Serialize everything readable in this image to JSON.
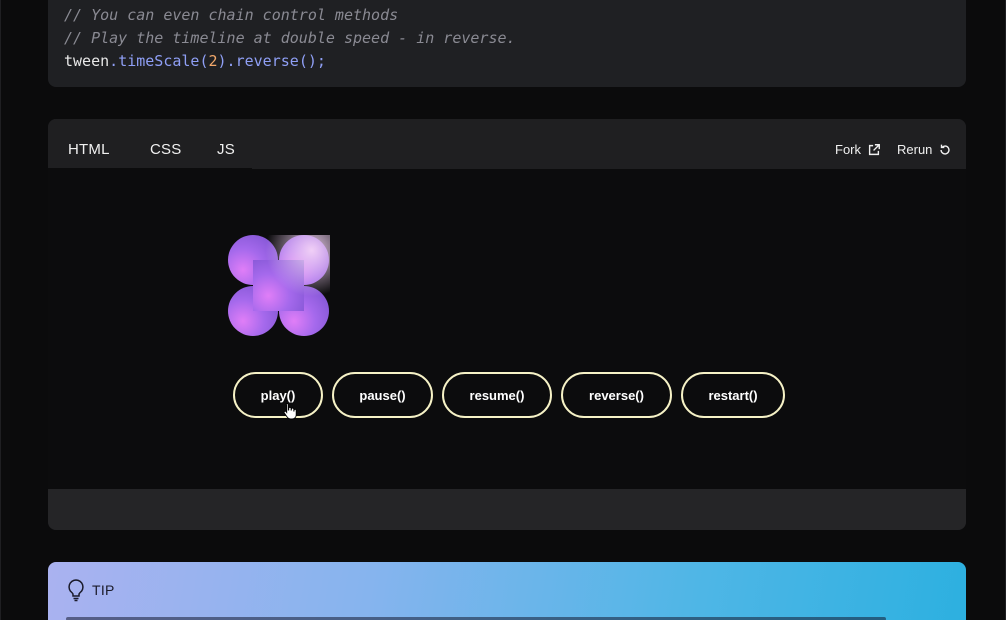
{
  "code": {
    "lines": [
      {
        "type": "comment",
        "text": "// You can even chain control methods"
      },
      {
        "type": "comment",
        "text": "// Play the timeline at double speed - in reverse."
      },
      {
        "type": "code",
        "tokens": [
          {
            "t": "ident",
            "text": "tween"
          },
          {
            "t": "punct",
            "text": "."
          },
          {
            "t": "method",
            "text": "timeScale"
          },
          {
            "t": "punct",
            "text": "("
          },
          {
            "t": "num",
            "text": "2"
          },
          {
            "t": "punct",
            "text": ")."
          },
          {
            "t": "method",
            "text": "reverse"
          },
          {
            "t": "punct",
            "text": "();"
          }
        ]
      }
    ]
  },
  "demo": {
    "tabs": [
      "HTML",
      "CSS",
      "JS"
    ],
    "fork_label": "Fork",
    "rerun_label": "Rerun",
    "buttons": [
      "play()",
      "pause()",
      "resume()",
      "reverse()",
      "restart()"
    ],
    "accent_colors": {
      "button_border": "#f6f2c6",
      "logo_light": "#f1c6f7",
      "logo_dark": "#8a56e6"
    }
  },
  "tip": {
    "label": "TIP"
  }
}
